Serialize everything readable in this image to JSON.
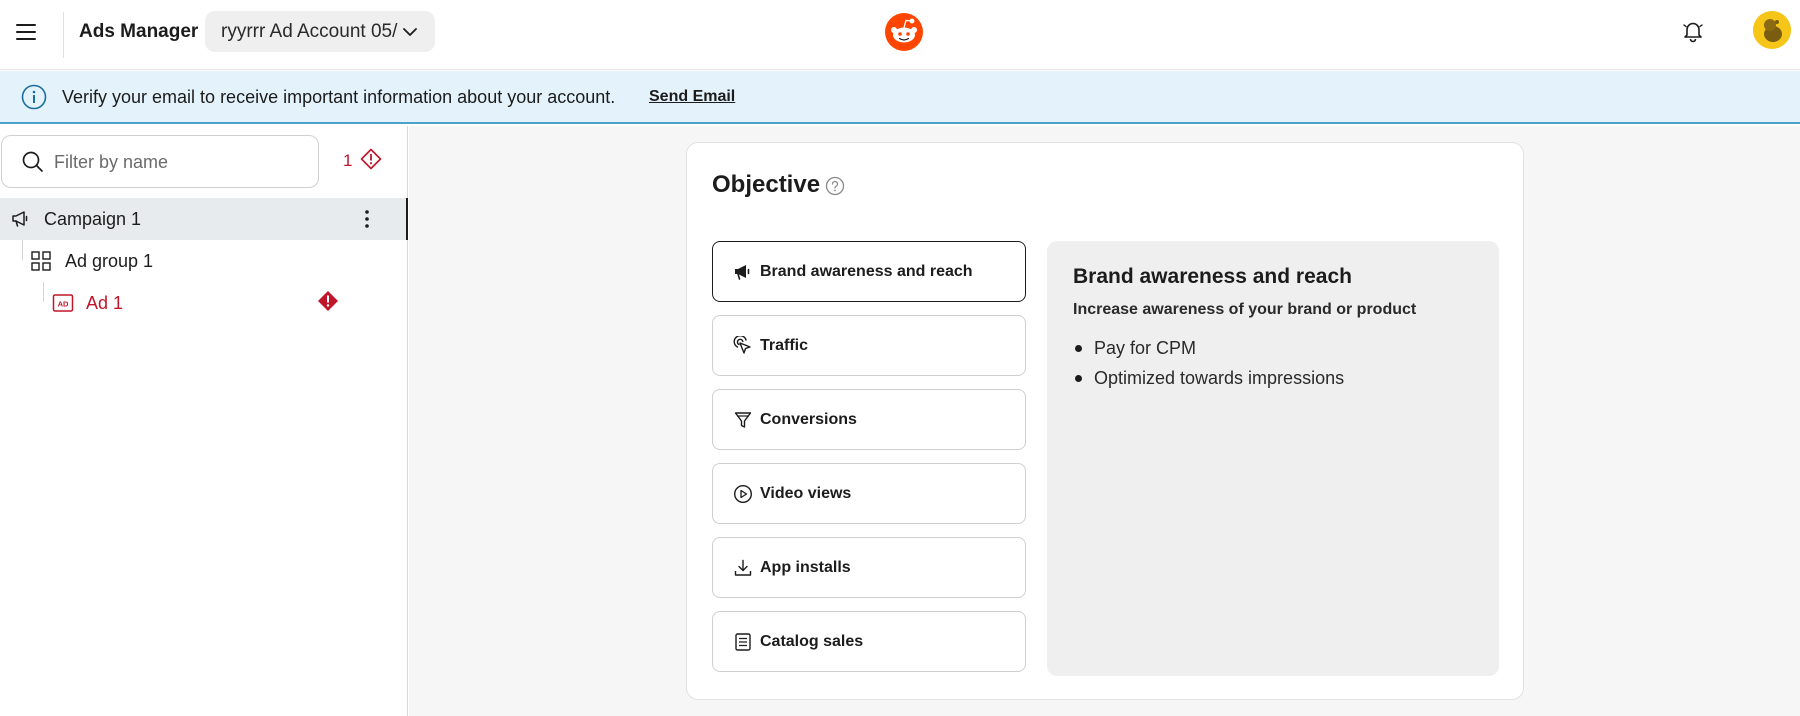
{
  "header": {
    "app_title": "Ads Manager",
    "account_selected": "ryyrrr Ad Account 05/",
    "menu_icon": "hamburger-menu-icon",
    "logo_icon": "reddit-logo",
    "bell_icon": "notification-bell-icon",
    "avatar_icon": "user-avatar"
  },
  "banner": {
    "message": "Verify your email to receive important information about your account.",
    "link_label": "Send Email",
    "icon": "info-icon",
    "background": "#e4f2fb"
  },
  "sidebar": {
    "search_placeholder": "Filter by name",
    "error_count": "1",
    "tree": [
      {
        "label": "Campaign 1",
        "icon": "megaphone-icon",
        "selected": true
      },
      {
        "label": "Ad group 1",
        "icon": "grid-icon",
        "selected": false
      },
      {
        "label": "Ad 1",
        "icon": "ad-icon",
        "selected": false,
        "has_error": true
      }
    ]
  },
  "objective": {
    "title": "Objective",
    "options": [
      {
        "label": "Brand awareness and reach",
        "icon": "megaphone-icon",
        "active": true
      },
      {
        "label": "Traffic",
        "icon": "cursor-click-icon",
        "active": false
      },
      {
        "label": "Conversions",
        "icon": "funnel-icon",
        "active": false
      },
      {
        "label": "Video views",
        "icon": "play-circle-icon",
        "active": false
      },
      {
        "label": "App installs",
        "icon": "download-icon",
        "active": false
      },
      {
        "label": "Catalog sales",
        "icon": "catalog-icon",
        "active": false
      }
    ],
    "detail": {
      "title": "Brand awareness and reach",
      "subtitle": "Increase awareness of your brand or product",
      "bullets": [
        "Pay for CPM",
        "Optimized towards impressions"
      ]
    }
  },
  "colors": {
    "error": "#c0162c",
    "accent": "#ff4500",
    "banner_border": "#4aa3c8"
  }
}
